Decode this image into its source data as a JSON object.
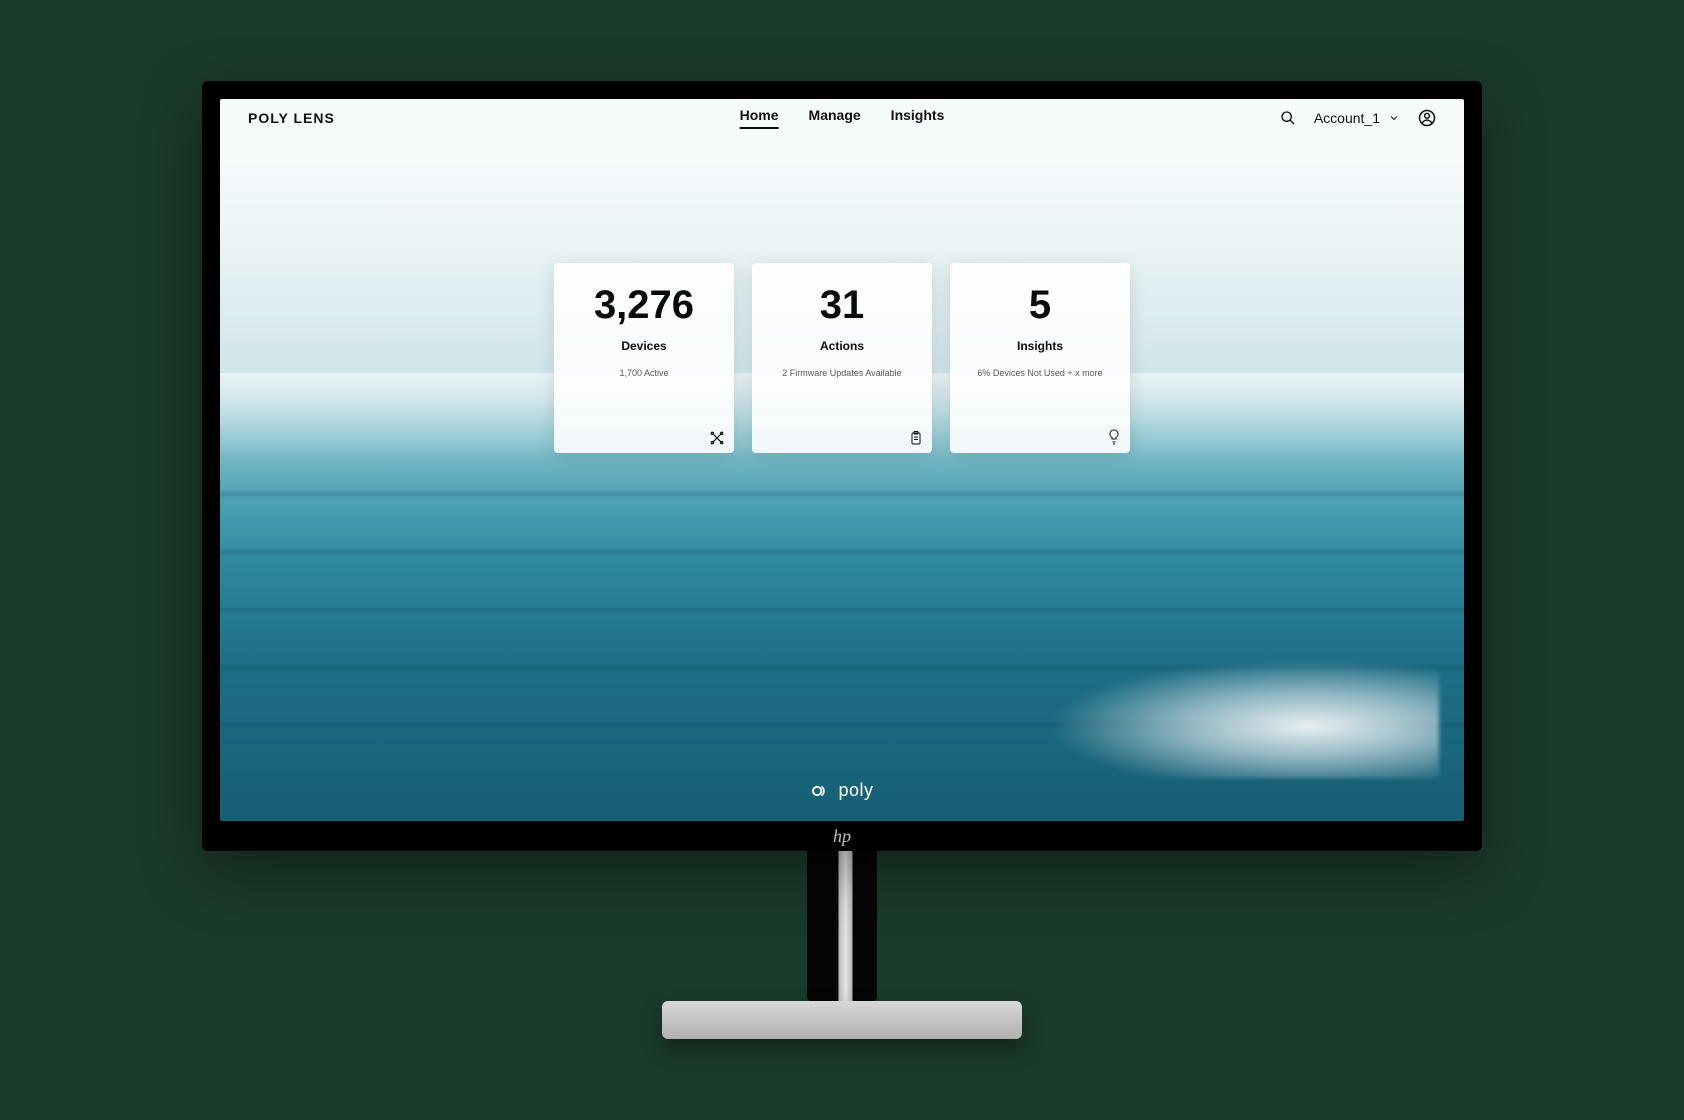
{
  "brand": "POLY LENS",
  "nav": {
    "items": [
      "Home",
      "Manage",
      "Insights"
    ],
    "active_index": 0
  },
  "account": {
    "name": "Account_1"
  },
  "cards": [
    {
      "value": "3,276",
      "title": "Devices",
      "subtitle": "1,700 Active",
      "icon": "link-icon"
    },
    {
      "value": "31",
      "title": "Actions",
      "subtitle": "2 Firmware Updates Available",
      "icon": "clipboard-icon"
    },
    {
      "value": "5",
      "title": "Insights",
      "subtitle": "6% Devices Not Used\n+ x more",
      "icon": "bulb-icon"
    }
  ],
  "footer_brand": "poly",
  "monitor_brand": "hp"
}
